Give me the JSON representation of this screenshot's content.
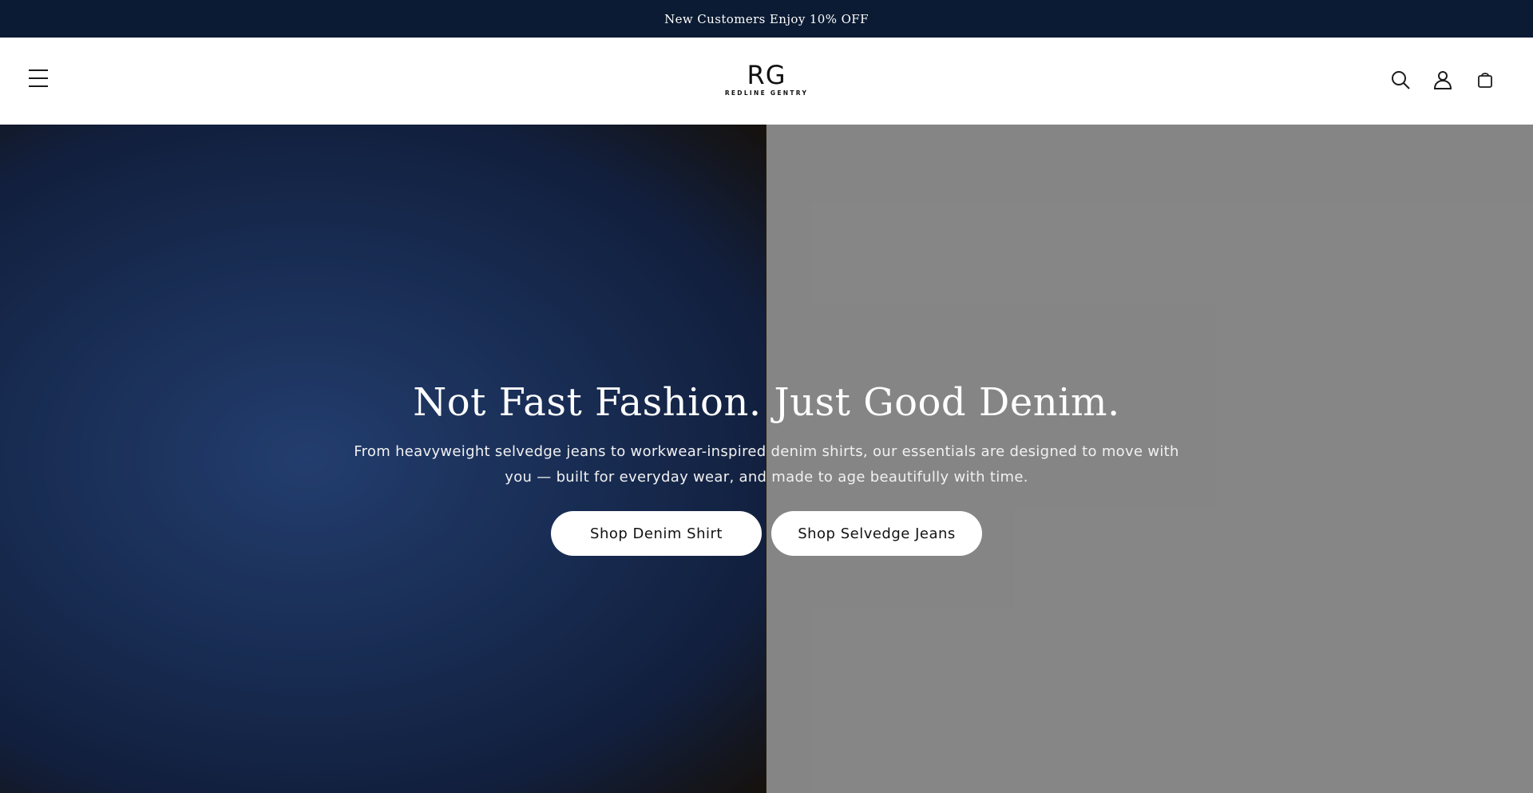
{
  "announcement": {
    "text": "New Customers Enjoy 10% OFF"
  },
  "header": {
    "logo_mark": "RG",
    "logo_text": "REDLINE GENTRY",
    "icons": [
      "menu-icon",
      "search-icon",
      "account-icon",
      "cart-icon"
    ]
  },
  "hero": {
    "title": "Not Fast Fashion. Just Good Denim.",
    "subtitle": "From heavyweight selvedge jeans to workwear-inspired denim shirts, our essentials are designed to move with you — built for everyday wear, and made to age beautifully with time.",
    "buttons": {
      "left": "Shop Denim Shirt",
      "right": "Shop Selvedge Jeans"
    },
    "colors": {
      "announcement_bg": "#0b1b33",
      "left_panel": "#1f3868",
      "right_panel": "#a3a3a3"
    }
  }
}
